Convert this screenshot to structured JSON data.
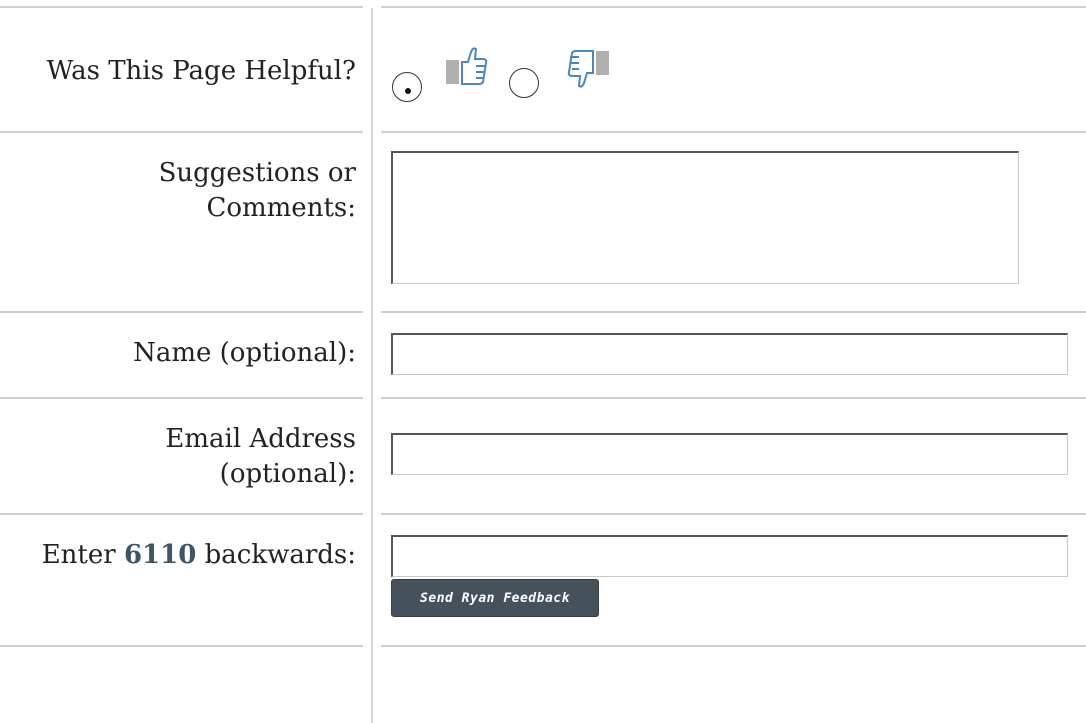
{
  "form": {
    "helpful": {
      "label": "Was This Page Helpful?",
      "selected": "yes",
      "options": [
        {
          "value": "yes",
          "icon": "thumbs-up-icon"
        },
        {
          "value": "no",
          "icon": "thumbs-down-icon"
        }
      ]
    },
    "comments": {
      "label_line1": "Suggestions or",
      "label_line2": "Comments:",
      "value": ""
    },
    "name": {
      "label": "Name (optional):",
      "value": ""
    },
    "email": {
      "label_line1": "Email Address",
      "label_line2": "(optional):",
      "value": ""
    },
    "captcha": {
      "label_prefix": "Enter ",
      "number": "6110",
      "label_suffix": " backwards:",
      "value": ""
    },
    "submit_label": "Send Ryan Feedback"
  },
  "colors": {
    "accent_number": "#3e5566",
    "button_bg": "#45525c",
    "thumb_blue": "#4a86c5",
    "thumb_gray": "#b0b0b0"
  }
}
